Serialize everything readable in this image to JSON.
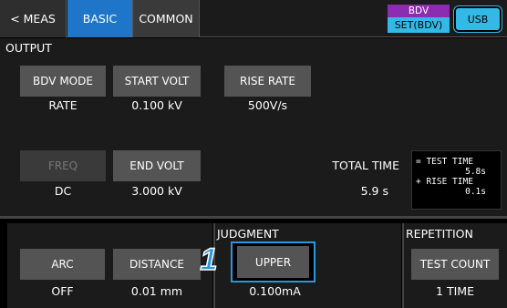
{
  "tabs": {
    "meas": "< MEAS",
    "basic": "BASIC",
    "common": "COMMON"
  },
  "mode": {
    "top": "BDV",
    "bottom": "SET(BDV)"
  },
  "usb": "USB",
  "output": {
    "title": "OUTPUT",
    "bdv_mode": {
      "label": "BDV MODE",
      "value": "RATE"
    },
    "start_volt": {
      "label": "START VOLT",
      "value": "0.100 kV"
    },
    "rise_rate": {
      "label": "RISE RATE",
      "value": "500V/s"
    },
    "freq": {
      "label": "FREQ",
      "value": "DC"
    },
    "end_volt": {
      "label": "END VOLT",
      "value": "3.000 kV"
    },
    "total_time": {
      "label": "TOTAL TIME",
      "value": "5.9 s"
    },
    "breakdown": {
      "line1": "= TEST TIME",
      "line2": "5.8s",
      "line3": "+ RISE TIME",
      "line4": "0.1s"
    }
  },
  "arc": {
    "label": "ARC",
    "value": "OFF"
  },
  "distance": {
    "label": "DISTANCE",
    "value": "0.01 mm"
  },
  "judgment": {
    "title": "JUDGMENT",
    "upper": {
      "label": "UPPER",
      "value": "0.100mA"
    }
  },
  "repetition": {
    "title": "REPETITION",
    "test_count": {
      "label": "TEST COUNT",
      "value": "1 TIME"
    }
  },
  "callout": "1",
  "colors": {
    "tab_active": "#1f76c8",
    "mode_top": "#8c2cb0",
    "mode_bottom": "#34b9e6",
    "callout": "#2b95de"
  }
}
